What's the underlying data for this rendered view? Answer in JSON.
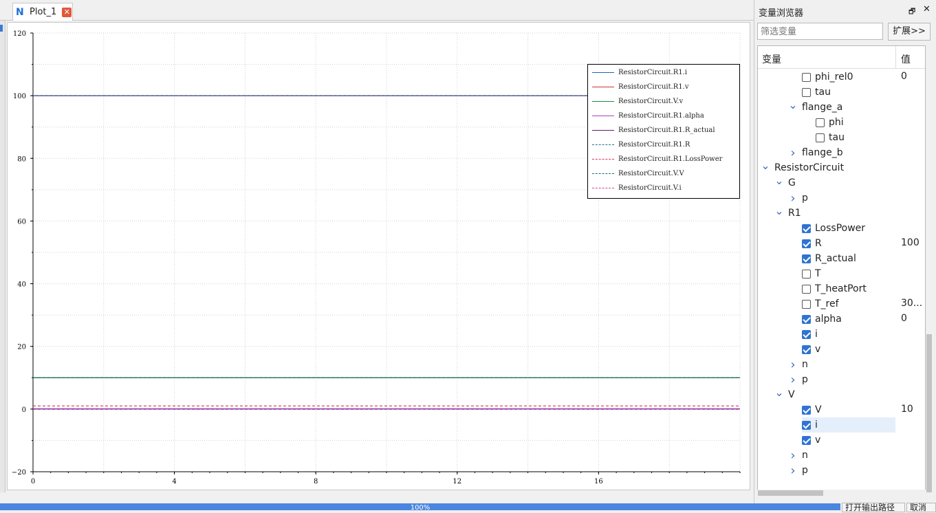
{
  "tab": {
    "title": "Plot_1",
    "close_symbol": "✕"
  },
  "chart_data": {
    "type": "line",
    "xlim": [
      0,
      20
    ],
    "ylim": [
      -20,
      120
    ],
    "x_ticks": [
      "0",
      "4",
      "8",
      "12",
      "16"
    ],
    "y_ticks": [
      "120",
      "100",
      "80",
      "60",
      "40",
      "20",
      "0",
      "−20"
    ],
    "grid": true,
    "legend_position": "top-right",
    "series": [
      {
        "name": "ResistorCircuit.R1.i",
        "color": "#1f5fbf",
        "dash": "solid",
        "x": [
          0,
          20
        ],
        "y": [
          0.1,
          0.1
        ]
      },
      {
        "name": "ResistorCircuit.R1.v",
        "color": "#d03030",
        "dash": "solid",
        "x": [
          0,
          20
        ],
        "y": [
          10,
          10
        ]
      },
      {
        "name": "ResistorCircuit.V.v",
        "color": "#1a8a3a",
        "dash": "solid",
        "x": [
          0,
          20
        ],
        "y": [
          10,
          10
        ]
      },
      {
        "name": "ResistorCircuit.R1.alpha",
        "color": "#b040c0",
        "dash": "solid",
        "x": [
          0,
          20
        ],
        "y": [
          0,
          0
        ]
      },
      {
        "name": "ResistorCircuit.R1.R_actual",
        "color": "#5a1a6a",
        "dash": "solid",
        "x": [
          0,
          20
        ],
        "y": [
          100,
          100
        ]
      },
      {
        "name": "ResistorCircuit.R1.R",
        "color": "#1f6f8f",
        "dash": "dashed",
        "x": [
          0,
          20
        ],
        "y": [
          100,
          100
        ]
      },
      {
        "name": "ResistorCircuit.R1.LossPower",
        "color": "#e03050",
        "dash": "dashed",
        "x": [
          0,
          20
        ],
        "y": [
          1,
          1
        ]
      },
      {
        "name": "ResistorCircuit.V.V",
        "color": "#1a6a7a",
        "dash": "dashed",
        "x": [
          0,
          20
        ],
        "y": [
          10,
          10
        ]
      },
      {
        "name": "ResistorCircuit.V.i",
        "color": "#d04090",
        "dash": "dashed",
        "x": [
          0,
          20
        ],
        "y": [
          -0.1,
          -0.1
        ]
      }
    ]
  },
  "variable_browser": {
    "title": "变量浏览器",
    "float_icon": "🗗",
    "close_icon": "✕",
    "filter_placeholder": "筛选变量",
    "expand_label": "扩展>>",
    "col_variable": "变量",
    "col_value": "值",
    "rows": [
      {
        "label": "phi_rel0",
        "checkbox": false,
        "value": "0"
      },
      {
        "label": "tau",
        "checkbox": false,
        "value": ""
      },
      {
        "label": "flange_a",
        "arrow": "expanded"
      },
      {
        "label": "phi",
        "checkbox": false,
        "value": ""
      },
      {
        "label": "tau",
        "checkbox": false,
        "value": ""
      },
      {
        "label": "flange_b",
        "arrow": "collapsed"
      },
      {
        "label": "ResistorCircuit",
        "arrow": "expanded"
      },
      {
        "label": "G",
        "arrow": "expanded"
      },
      {
        "label": "p",
        "arrow": "collapsed"
      },
      {
        "label": "R1",
        "arrow": "expanded"
      },
      {
        "label": "LossPower",
        "checkbox": true,
        "value": ""
      },
      {
        "label": "R",
        "checkbox": true,
        "value": "100"
      },
      {
        "label": "R_actual",
        "checkbox": true,
        "value": ""
      },
      {
        "label": "T",
        "checkbox": false,
        "value": ""
      },
      {
        "label": "T_heatPort",
        "checkbox": false,
        "value": ""
      },
      {
        "label": "T_ref",
        "checkbox": false,
        "value": "30..."
      },
      {
        "label": "alpha",
        "checkbox": true,
        "value": "0"
      },
      {
        "label": "i",
        "checkbox": true,
        "value": ""
      },
      {
        "label": "v",
        "checkbox": true,
        "value": ""
      },
      {
        "label": "n",
        "arrow": "collapsed"
      },
      {
        "label": "p",
        "arrow": "collapsed"
      },
      {
        "label": "V",
        "arrow": "expanded"
      },
      {
        "label": "V",
        "checkbox": true,
        "value": "10"
      },
      {
        "label": "i",
        "checkbox": true,
        "value": ""
      },
      {
        "label": "v",
        "checkbox": true,
        "value": ""
      },
      {
        "label": "n",
        "arrow": "collapsed"
      },
      {
        "label": "p",
        "arrow": "collapsed"
      }
    ]
  },
  "status": {
    "progress_text": "100%",
    "progress": 1.0,
    "open_output_label": "打开输出路径",
    "cancel_label": "取消"
  }
}
